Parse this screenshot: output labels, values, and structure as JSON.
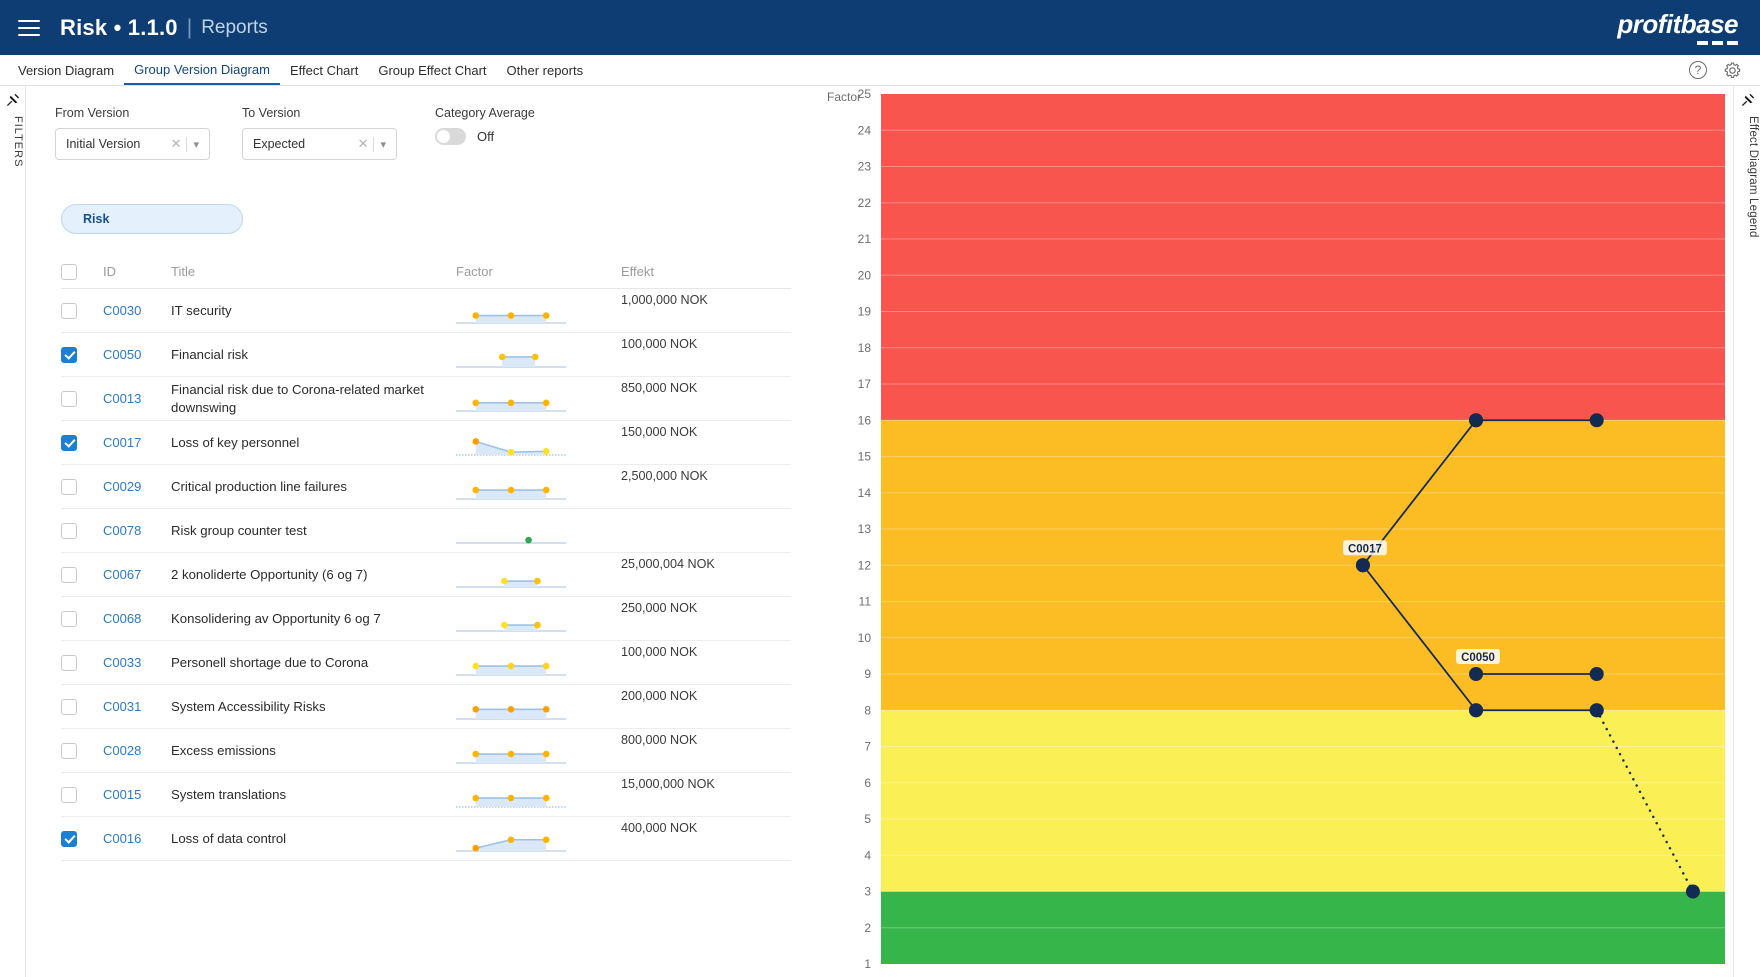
{
  "header": {
    "menu_icon": "hamburger-icon",
    "title": "Risk • 1.1.0",
    "separator": "|",
    "subtitle": "Reports",
    "brand": "profitbase"
  },
  "tabs": [
    {
      "label": "Version Diagram",
      "active": false
    },
    {
      "label": "Group Version Diagram",
      "active": true
    },
    {
      "label": "Effect Chart",
      "active": false
    },
    {
      "label": "Group Effect Chart",
      "active": false
    },
    {
      "label": "Other reports",
      "active": false
    }
  ],
  "tabbar_actions": [
    {
      "name": "help-icon",
      "glyph": "?"
    },
    {
      "name": "gear-icon",
      "glyph": "gear"
    }
  ],
  "left_rail": {
    "label": "FILTERS",
    "pin_icon": "pin-icon"
  },
  "right_rail": {
    "label": "Effect Diagram Legend",
    "pin_icon": "pin-icon"
  },
  "filters": {
    "from_version": {
      "label": "From Version",
      "value": "Initial Version"
    },
    "to_version": {
      "label": "To Version",
      "value": "Expected"
    },
    "category_average": {
      "label": "Category Average",
      "state": "Off"
    }
  },
  "risk_pill": {
    "label": "Risk"
  },
  "table": {
    "columns": [
      "ID",
      "Title",
      "Factor",
      "Effekt"
    ],
    "rows": [
      {
        "checked": false,
        "id": "C0030",
        "title": "IT security",
        "effekt": "1,000,000 NOK",
        "spark": {
          "points": [
            [
              0.18,
              0.62
            ],
            [
              0.5,
              0.62
            ],
            [
              0.82,
              0.62
            ]
          ],
          "colors": [
            "#FFB300",
            "#FFB300",
            "#FFB300"
          ],
          "area": true,
          "baseline": "solid"
        }
      },
      {
        "checked": true,
        "id": "C0050",
        "title": "Financial risk",
        "effekt": "100,000 NOK",
        "spark": {
          "points": [
            [
              0.42,
              0.55
            ],
            [
              0.72,
              0.55
            ]
          ],
          "colors": [
            "#FFC107",
            "#FFC107"
          ],
          "area": true,
          "baseline": "solid"
        }
      },
      {
        "checked": false,
        "id": "C0013",
        "title": "Financial risk due to Corona-related market downswing",
        "effekt": "850,000 NOK",
        "spark": {
          "points": [
            [
              0.18,
              0.6
            ],
            [
              0.5,
              0.6
            ],
            [
              0.82,
              0.6
            ]
          ],
          "colors": [
            "#FFB300",
            "#FFB300",
            "#FFB300"
          ],
          "area": true,
          "baseline": "solid"
        }
      },
      {
        "checked": true,
        "id": "C0017",
        "title": "Loss of key personnel",
        "effekt": "150,000 NOK",
        "spark": {
          "points": [
            [
              0.18,
              0.46
            ],
            [
              0.5,
              0.74
            ],
            [
              0.82,
              0.72
            ]
          ],
          "colors": [
            "#FFA000",
            "#FFE022",
            "#FFE022"
          ],
          "area": true,
          "baseline": "dotted"
        }
      },
      {
        "checked": false,
        "id": "C0029",
        "title": "Critical production line failures",
        "effekt": "2,500,000 NOK",
        "spark": {
          "points": [
            [
              0.18,
              0.58
            ],
            [
              0.5,
              0.58
            ],
            [
              0.82,
              0.58
            ]
          ],
          "colors": [
            "#FFB300",
            "#FFB300",
            "#FFB300"
          ],
          "area": true,
          "baseline": "solid"
        }
      },
      {
        "checked": false,
        "id": "C0078",
        "title": "Risk group counter test",
        "effekt": "",
        "spark": {
          "points": [
            [
              0.66,
              0.74
            ]
          ],
          "colors": [
            "#2EA84F"
          ],
          "area": false,
          "baseline": "solid"
        }
      },
      {
        "checked": false,
        "id": "C0067",
        "title": "2 konoliderte Opportunity (6 og 7)",
        "effekt": "25,000,004 NOK",
        "spark": {
          "points": [
            [
              0.44,
              0.66
            ],
            [
              0.74,
              0.66
            ]
          ],
          "colors": [
            "#FFE022",
            "#FFC107"
          ],
          "area": true,
          "baseline": "solid"
        }
      },
      {
        "checked": false,
        "id": "C0068",
        "title": "Konsolidering av Opportunity 6 og 7",
        "effekt": "250,000 NOK",
        "spark": {
          "points": [
            [
              0.44,
              0.66
            ],
            [
              0.74,
              0.66
            ]
          ],
          "colors": [
            "#FFE022",
            "#FFC107"
          ],
          "area": true,
          "baseline": "solid"
        }
      },
      {
        "checked": false,
        "id": "C0033",
        "title": "Personell shortage due to Corona",
        "effekt": "100,000 NOK",
        "spark": {
          "points": [
            [
              0.18,
              0.58
            ],
            [
              0.5,
              0.58
            ],
            [
              0.82,
              0.58
            ]
          ],
          "colors": [
            "#FFE022",
            "#FFD21E",
            "#FFD21E"
          ],
          "area": true,
          "baseline": "solid"
        }
      },
      {
        "checked": false,
        "id": "C0031",
        "title": " System Accessibility Risks",
        "effekt": "200,000 NOK",
        "spark": {
          "points": [
            [
              0.18,
              0.56
            ],
            [
              0.5,
              0.56
            ],
            [
              0.82,
              0.56
            ]
          ],
          "colors": [
            "#FFA000",
            "#FFA000",
            "#FFA000"
          ],
          "area": true,
          "baseline": "solid"
        }
      },
      {
        "checked": false,
        "id": "C0028",
        "title": "Excess emissions",
        "effekt": "800,000 NOK",
        "spark": {
          "points": [
            [
              0.18,
              0.58
            ],
            [
              0.5,
              0.58
            ],
            [
              0.82,
              0.58
            ]
          ],
          "colors": [
            "#FFB300",
            "#FFB300",
            "#FFB300"
          ],
          "area": true,
          "baseline": "solid"
        }
      },
      {
        "checked": false,
        "id": "C0015",
        "title": "System translations",
        "effekt": "15,000,000 NOK",
        "spark": {
          "points": [
            [
              0.18,
              0.58
            ],
            [
              0.5,
              0.58
            ],
            [
              0.82,
              0.58
            ]
          ],
          "colors": [
            "#FFB300",
            "#FFB300",
            "#FFB300"
          ],
          "area": true,
          "baseline": "dotted"
        }
      },
      {
        "checked": true,
        "id": "C0016",
        "title": "Loss of data control",
        "effekt": "400,000 NOK",
        "spark": {
          "points": [
            [
              0.18,
              0.74
            ],
            [
              0.5,
              0.52
            ],
            [
              0.82,
              0.52
            ]
          ],
          "colors": [
            "#FFA000",
            "#FFB300",
            "#FFB300"
          ],
          "area": true,
          "baseline": "solid"
        }
      }
    ]
  },
  "chart_data": {
    "type": "line",
    "title": "",
    "ylabel": "Factor",
    "xlabel": "",
    "ylim": [
      1,
      25
    ],
    "yticks": [
      25,
      24,
      23,
      22,
      21,
      20,
      19,
      18,
      17,
      16,
      15,
      14,
      13,
      12,
      11,
      10,
      9,
      8,
      7,
      6,
      5,
      4,
      3,
      2,
      1
    ],
    "grid": true,
    "legend": "none",
    "bands": [
      {
        "name": "red",
        "color": "#F9554F",
        "from": 16,
        "to": 25
      },
      {
        "name": "orange",
        "color": "#FBBC24",
        "from": 8,
        "to": 16
      },
      {
        "name": "yellow",
        "color": "#FAEF55",
        "from": 3,
        "to": 8
      },
      {
        "name": "green",
        "color": "#35B54A",
        "from": 1,
        "to": 3
      }
    ],
    "series": [
      {
        "name": "C0016",
        "label": "",
        "label_point": -1,
        "style": "solid",
        "x": [
          0.705,
          0.848
        ],
        "y": [
          16,
          16
        ]
      },
      {
        "name": "C0017",
        "label": "C0017",
        "label_point": 0,
        "style": "solid",
        "x": [
          0.571,
          0.705
        ],
        "y": [
          12,
          16
        ]
      },
      {
        "name": "C0017b",
        "label": "",
        "label_point": -1,
        "style": "solid",
        "x": [
          0.571,
          0.705
        ],
        "y": [
          12,
          8
        ]
      },
      {
        "name": "C0050",
        "label": "C0050",
        "label_point": 0,
        "style": "solid",
        "x": [
          0.705,
          0.848
        ],
        "y": [
          9,
          9
        ]
      },
      {
        "name": "C0050b",
        "label": "",
        "label_point": -1,
        "style": "solid",
        "x": [
          0.705,
          0.848
        ],
        "y": [
          8,
          8
        ]
      },
      {
        "name": "dropline",
        "label": "",
        "label_point": -1,
        "style": "dotted",
        "x": [
          0.848,
          0.962
        ],
        "y": [
          8,
          3
        ]
      }
    ],
    "series_color": "#132B53",
    "point_labels": [
      {
        "text": "C0017",
        "x": 0.571,
        "y": 12
      },
      {
        "text": "C0050",
        "x": 0.705,
        "y": 9
      }
    ]
  }
}
